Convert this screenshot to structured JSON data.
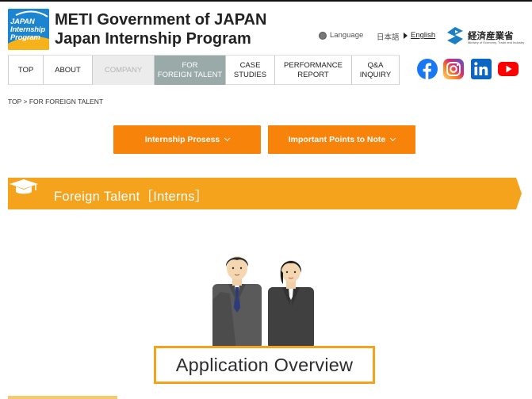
{
  "header": {
    "logo_lines": [
      "JAPAN",
      "Internship",
      "Program"
    ],
    "title_line1": "METI Government of JAPAN",
    "title_line2": "Japan Internship Program"
  },
  "language": {
    "label": "Language",
    "japanese": "日本語",
    "english": "English"
  },
  "meti": {
    "name_jp": "経済産業省",
    "name_en": "Ministry of Economy, Trade and Industry"
  },
  "nav": {
    "items": [
      {
        "label": "TOP",
        "state": "normal"
      },
      {
        "label": "ABOUT",
        "state": "normal"
      },
      {
        "label": "COMPANY",
        "state": "disabled"
      },
      {
        "label": "FOR\nFOREIGN TALENT",
        "state": "active"
      },
      {
        "label": "CASE\nSTUDIES",
        "state": "normal"
      },
      {
        "label": "PERFORMANCE\nREPORT",
        "state": "normal"
      },
      {
        "label": "Q&A\nINQUIRY",
        "state": "normal"
      }
    ]
  },
  "social": [
    {
      "name": "facebook-icon",
      "color": "#1877f2"
    },
    {
      "name": "instagram-icon",
      "color": "#d6249f"
    },
    {
      "name": "linkedin-icon",
      "color": "#0a66c2"
    },
    {
      "name": "youtube-icon",
      "color": "#ff0000"
    }
  ],
  "breadcrumb": {
    "home": "TOP",
    "separator": " > ",
    "current": "FOR FOREIGN TALENT"
  },
  "buttons": {
    "internship_process": "Internship Prosess",
    "important_points": "Important Points to Note"
  },
  "section": {
    "title": "Foreign Talent［Interns］"
  },
  "overview": {
    "title": "Application Overview"
  },
  "colors": {
    "accent_orange": "#f7830a",
    "banner_orange": "#f5a31d",
    "logo_blue": "#1d84cf",
    "nav_active": "#9aaaa9"
  }
}
